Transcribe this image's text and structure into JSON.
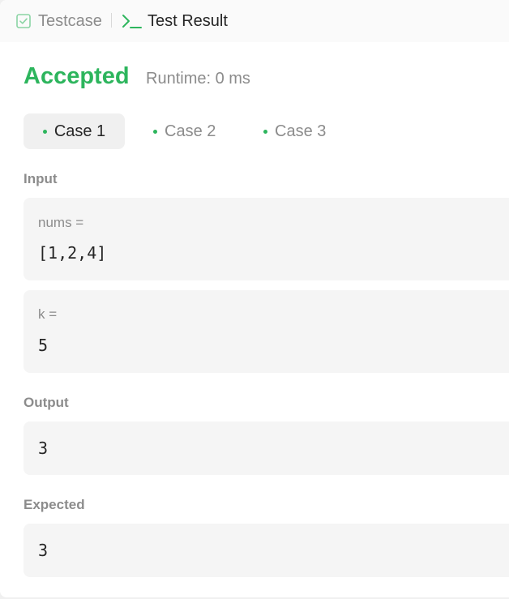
{
  "tabs": {
    "testcase_label": "Testcase",
    "result_label": "Test Result"
  },
  "result": {
    "status": "Accepted",
    "runtime": "Runtime: 0 ms"
  },
  "cases": [
    {
      "label": "Case 1"
    },
    {
      "label": "Case 2"
    },
    {
      "label": "Case 3"
    }
  ],
  "input": {
    "label": "Input",
    "params": [
      {
        "name": "nums =",
        "value": "[1,2,4]"
      },
      {
        "name": "k =",
        "value": "5"
      }
    ]
  },
  "output": {
    "label": "Output",
    "value": "3"
  },
  "expected": {
    "label": "Expected",
    "value": "3"
  },
  "colors": {
    "accent_green": "#2db55d",
    "muted_text": "#8c8c8c",
    "box_bg": "#f5f5f5"
  },
  "icons": {
    "testcase": "check-square-icon",
    "result": "terminal-icon"
  }
}
